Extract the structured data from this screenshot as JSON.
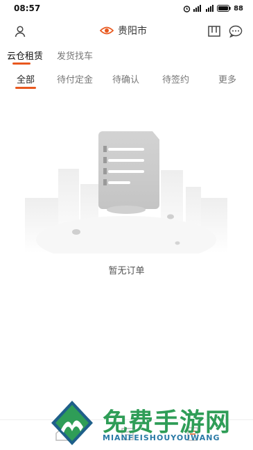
{
  "status_bar": {
    "time": "08:57",
    "battery": "88"
  },
  "header": {
    "location": "贵阳市",
    "icons": [
      "user-icon",
      "location-target-icon",
      "scan-icon",
      "message-icon"
    ]
  },
  "top_tabs": [
    {
      "label": "云仓租赁",
      "active": true
    },
    {
      "label": "发货找车",
      "active": false
    }
  ],
  "order_tabs": [
    {
      "label": "全部",
      "active": true
    },
    {
      "label": "待付定金",
      "active": false
    },
    {
      "label": "待确认",
      "active": false
    },
    {
      "label": "待签约",
      "active": false
    },
    {
      "label": "更多",
      "active": false
    }
  ],
  "empty_state": {
    "text": "暂无订单"
  },
  "watermark": {
    "title": "免费手游网",
    "subtitle": "MIANFEISHOUYOUWANG"
  },
  "colors": {
    "accent": "#e8581e",
    "watermark_green": "#2f9d57",
    "watermark_blue": "#2a7aa6"
  }
}
